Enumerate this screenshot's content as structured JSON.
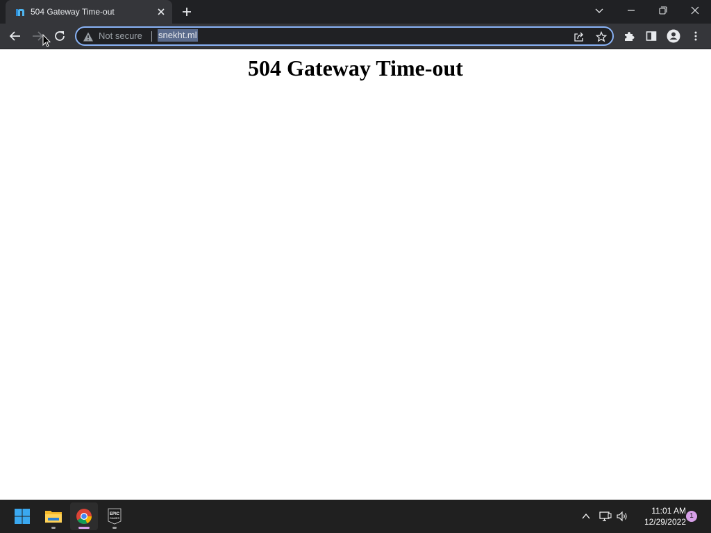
{
  "browser": {
    "tab": {
      "title": "504 Gateway Time-out",
      "favicon": "n-favicon-icon"
    },
    "window_controls": [
      "tab-search-icon",
      "minimize-icon",
      "restore-icon",
      "close-icon"
    ],
    "toolbar": {
      "back": "back-arrow-icon",
      "forward": "forward-arrow-icon",
      "reload": "reload-icon"
    },
    "omnibox": {
      "security_label": "Not secure",
      "url": "snekht.ml",
      "warning_icon": "warning-icon",
      "share_icon": "share-icon",
      "bookmark_icon": "star-icon"
    },
    "extensions_icon": "puzzle-icon",
    "side_panel_icon": "side-panel-icon",
    "profile_icon": "profile-icon",
    "menu_icon": "kebab-menu-icon"
  },
  "page": {
    "heading": "504 Gateway Time-out"
  },
  "taskbar": {
    "apps": [
      {
        "name": "Start",
        "icon": "windows-start-icon"
      },
      {
        "name": "File Explorer",
        "icon": "folder-icon"
      },
      {
        "name": "Google Chrome",
        "icon": "chrome-icon"
      },
      {
        "name": "Epic Games",
        "icon": "epic-games-icon",
        "label": "EPIC\nGAMES"
      }
    ],
    "tray": {
      "time": "11:01 AM",
      "date": "12/29/2022",
      "notification_count": "1"
    }
  },
  "colors": {
    "titlebar": "#202124",
    "toolbar": "#35363a",
    "omnibox_focus": "#8ab4f8",
    "taskbar": "#202020",
    "active_indicator": "#d7a0e8"
  }
}
